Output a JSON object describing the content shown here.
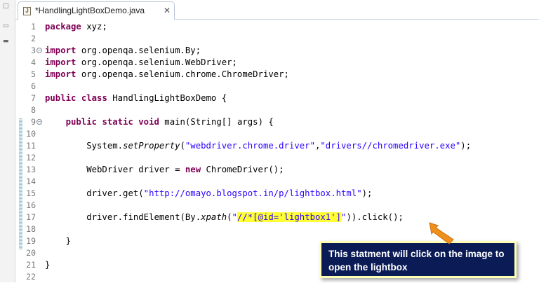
{
  "tab": {
    "title": "*HandlingLightBoxDemo.java",
    "icon": "java-file-icon",
    "icon_letter": "J",
    "close_glyph": "✕"
  },
  "left_strip": {
    "marks": [
      "□",
      "▭",
      "▬"
    ]
  },
  "code_lines": [
    {
      "n": "1",
      "segs": [
        {
          "t": "package",
          "c": "kw"
        },
        {
          "t": " xyz;",
          "c": ""
        }
      ]
    },
    {
      "n": "2",
      "segs": []
    },
    {
      "n": "3",
      "fold": "−",
      "segs": [
        {
          "t": "import",
          "c": "kw"
        },
        {
          "t": " org.openqa.selenium.By;",
          "c": ""
        }
      ]
    },
    {
      "n": "4",
      "segs": [
        {
          "t": "import",
          "c": "kw"
        },
        {
          "t": " org.openqa.selenium.WebDriver;",
          "c": ""
        }
      ]
    },
    {
      "n": "5",
      "segs": [
        {
          "t": "import",
          "c": "kw"
        },
        {
          "t": " org.openqa.selenium.chrome.ChromeDriver;",
          "c": ""
        }
      ]
    },
    {
      "n": "6",
      "segs": []
    },
    {
      "n": "7",
      "segs": [
        {
          "t": "public",
          "c": "kw"
        },
        {
          "t": " ",
          "c": ""
        },
        {
          "t": "class",
          "c": "kw"
        },
        {
          "t": " HandlingLightBoxDemo {",
          "c": ""
        }
      ]
    },
    {
      "n": "8",
      "segs": []
    },
    {
      "n": "9",
      "fold": "−",
      "segs": [
        {
          "t": "    ",
          "c": ""
        },
        {
          "t": "public",
          "c": "kw"
        },
        {
          "t": " ",
          "c": ""
        },
        {
          "t": "static",
          "c": "kw"
        },
        {
          "t": " ",
          "c": ""
        },
        {
          "t": "void",
          "c": "kw"
        },
        {
          "t": " main(String[] args) {",
          "c": ""
        }
      ]
    },
    {
      "n": "10",
      "segs": []
    },
    {
      "n": "11",
      "segs": [
        {
          "t": "        System.",
          "c": ""
        },
        {
          "t": "setProperty",
          "c": "it"
        },
        {
          "t": "(",
          "c": ""
        },
        {
          "t": "\"webdriver.chrome.driver\"",
          "c": "str"
        },
        {
          "t": ",",
          "c": ""
        },
        {
          "t": "\"drivers//chromedriver.exe\"",
          "c": "str"
        },
        {
          "t": ");",
          "c": ""
        }
      ]
    },
    {
      "n": "12",
      "segs": []
    },
    {
      "n": "13",
      "segs": [
        {
          "t": "        WebDriver driver = ",
          "c": ""
        },
        {
          "t": "new",
          "c": "kw"
        },
        {
          "t": " ChromeDriver();",
          "c": ""
        }
      ]
    },
    {
      "n": "14",
      "segs": []
    },
    {
      "n": "15",
      "segs": [
        {
          "t": "        driver.get(",
          "c": ""
        },
        {
          "t": "\"http://omayo.blogspot.in/p/lightbox.html\"",
          "c": "str"
        },
        {
          "t": ");",
          "c": ""
        }
      ]
    },
    {
      "n": "16",
      "segs": []
    },
    {
      "n": "17",
      "segs": [
        {
          "t": "        driver.findElement(By.",
          "c": ""
        },
        {
          "t": "xpath",
          "c": "it"
        },
        {
          "t": "(",
          "c": ""
        },
        {
          "t": "\"",
          "c": "str"
        },
        {
          "t": "//*[@id='lightbox1']",
          "c": "str hl"
        },
        {
          "t": "\"",
          "c": "str"
        },
        {
          "t": ")).click();",
          "c": ""
        }
      ]
    },
    {
      "n": "18",
      "segs": []
    },
    {
      "n": "19",
      "segs": [
        {
          "t": "    }",
          "c": ""
        }
      ]
    },
    {
      "n": "20",
      "segs": []
    },
    {
      "n": "21",
      "segs": [
        {
          "t": "}",
          "c": ""
        }
      ]
    },
    {
      "n": "22",
      "segs": []
    }
  ],
  "annotation": {
    "text": "This statment will click on the image to open the lightbox",
    "arrow_color": "#f0901c",
    "box_color": "#0a1b56",
    "border_color": "#ffffb5"
  },
  "colors": {
    "keyword": "#7f0055",
    "string": "#2a00ff",
    "highlight": "#ffff33"
  }
}
